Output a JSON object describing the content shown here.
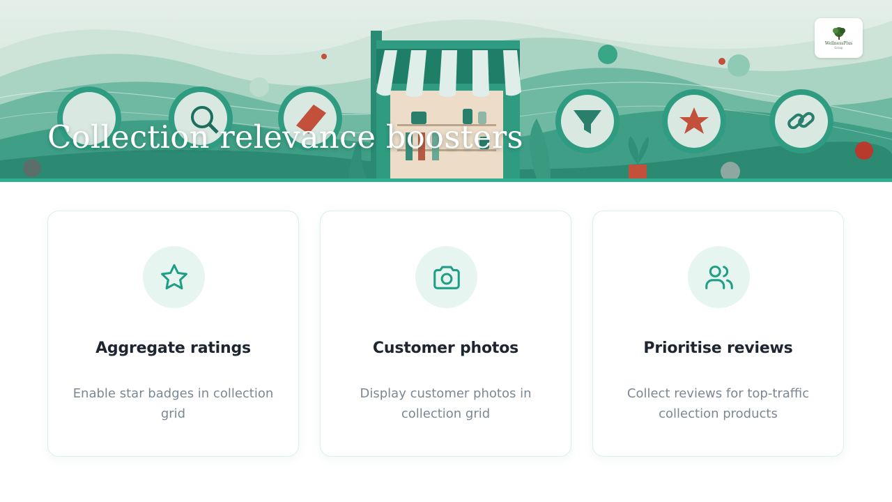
{
  "hero": {
    "title": "Collection relevance boosters",
    "logo_text": "WellnessPlus",
    "logo_sub": "Group"
  },
  "colors": {
    "accent": "#2fae94",
    "icon_stroke": "#1f9e86",
    "icon_bg": "#e7f5f1",
    "title_text": "#1c2530",
    "body_text": "#7a8794"
  },
  "cards": [
    {
      "icon": "star-icon",
      "title": "Aggregate ratings",
      "description": "Enable star badges in collection grid"
    },
    {
      "icon": "camera-icon",
      "title": "Customer photos",
      "description": "Display customer photos in collection grid"
    },
    {
      "icon": "users-icon",
      "title": "Prioritise reviews",
      "description": "Collect reviews for top-traffic collection products"
    }
  ]
}
